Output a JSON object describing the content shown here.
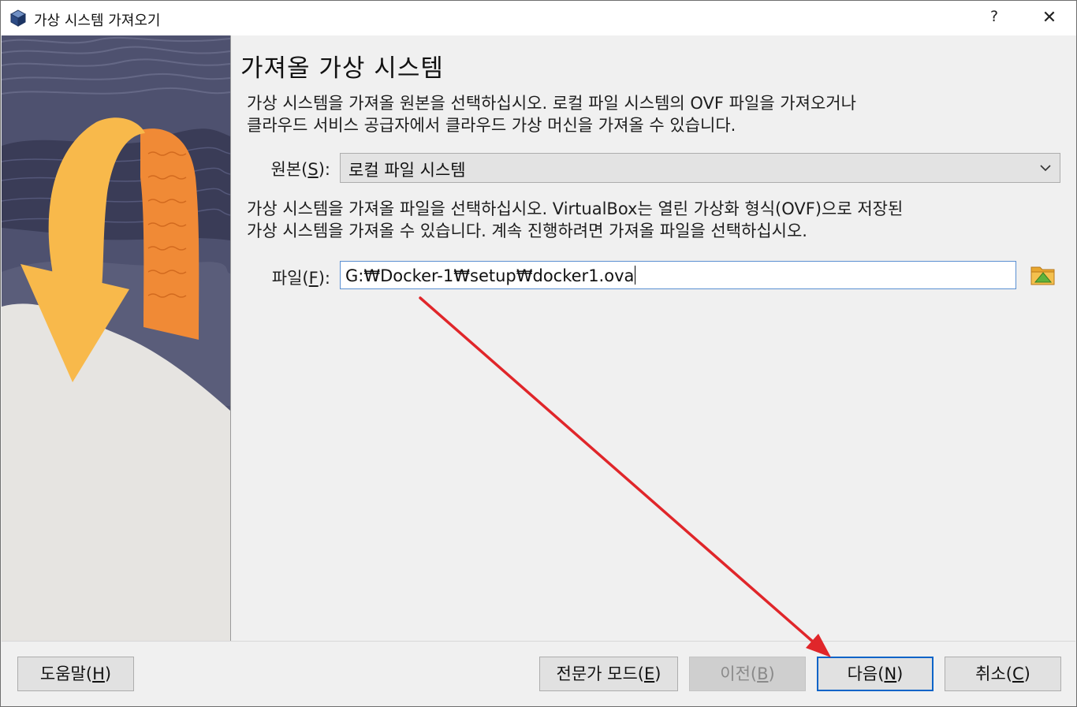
{
  "window": {
    "title": "가상 시스템 가져오기",
    "help_label": "?",
    "close_label": "✕"
  },
  "page": {
    "title": "가져올 가상 시스템",
    "description1": "가상 시스템을 가져올 원본을 선택하십시오. 로컬 파일 시스템의 OVF 파일을 가져오거나\n클라우드 서비스 공급자에서 클라우드 가상 머신을 가져올 수 있습니다.",
    "description2": "가상 시스템을 가져올 파일을 선택하십시오. VirtualBox는 열린 가상화 형식(OVF)으로 저장된\n가상 시스템을 가져올 수 있습니다. 계속 진행하려면 가져올 파일을 선택하십시오."
  },
  "source": {
    "label_prefix": "원본(",
    "label_mnemonic": "S",
    "label_suffix": "):",
    "selected": "로컬 파일 시스템"
  },
  "file": {
    "label_prefix": "파일(",
    "label_mnemonic": "F",
    "label_suffix": "):",
    "value": "G:₩Docker-1₩setup₩docker1.ova"
  },
  "buttons": {
    "help": {
      "prefix": "도움말(",
      "mnemonic": "H",
      "suffix": ")"
    },
    "expert": {
      "prefix": "전문가 모드(",
      "mnemonic": "E",
      "suffix": ")"
    },
    "back": {
      "prefix": "이전(",
      "mnemonic": "B",
      "suffix": ")"
    },
    "next": {
      "prefix": "다음(",
      "mnemonic": "N",
      "suffix": ")"
    },
    "cancel": {
      "prefix": "취소(",
      "mnemonic": "C",
      "suffix": ")"
    }
  },
  "icons": {
    "app": "virtualbox-cube-icon",
    "folder": "folder-open-icon",
    "dropdown": "chevron-down-icon"
  },
  "colors": {
    "annotation_arrow": "#e0262a",
    "focus_border": "#0a64c8",
    "input_border": "#5a8fd2",
    "banner_bg": "#4c4f6d",
    "arrow_yellow": "#f8b94b",
    "arrow_orange": "#f08a36"
  }
}
